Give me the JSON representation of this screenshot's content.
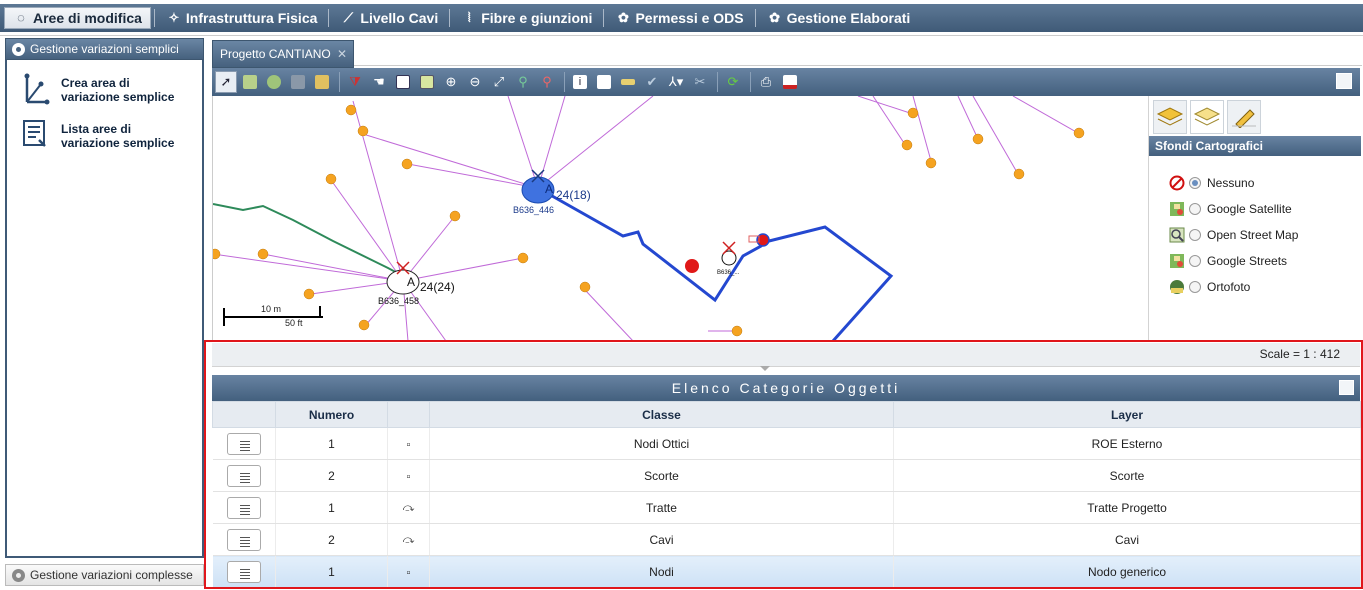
{
  "menu": {
    "items": [
      {
        "label": "Aree di modifica",
        "icon": "area-icon",
        "active": true
      },
      {
        "label": "Infrastruttura Fisica",
        "icon": "infrastructure-icon",
        "active": false
      },
      {
        "label": "Livello Cavi",
        "icon": "cable-icon",
        "active": false
      },
      {
        "label": "Fibre e giunzioni",
        "icon": "fiber-icon",
        "active": false
      },
      {
        "label": "Permessi e ODS",
        "icon": "gear-icon",
        "active": false
      },
      {
        "label": "Gestione Elaborati",
        "icon": "gear-icon",
        "active": false
      }
    ]
  },
  "left_panel": {
    "header": "Gestione variazioni semplici",
    "items": [
      {
        "label": "Crea area di variazione semplice",
        "icon": "create-area-icon"
      },
      {
        "label": "Lista aree di variazione semplice",
        "icon": "list-area-icon"
      }
    ],
    "footer": "Gestione variazioni complesse"
  },
  "project_tab": {
    "label": "Progetto CANTIANO"
  },
  "map": {
    "labels": {
      "node_a": "B636_446",
      "node_a_count": "24(18)",
      "node_b": "B636_458",
      "node_b_count": "24(24)",
      "node_c": "B636_..."
    },
    "scalebar": {
      "metric": "10 m",
      "imperial": "50 ft"
    },
    "scale_text": "Scale = 1 : 412"
  },
  "carto": {
    "title": "Sfondi Cartografici",
    "options": [
      {
        "label": "Nessuno",
        "icon": "no-entry-icon",
        "selected": true
      },
      {
        "label": "Google Satellite",
        "icon": "map-icon",
        "selected": false
      },
      {
        "label": "Open Street Map",
        "icon": "map-icon",
        "selected": false
      },
      {
        "label": "Google Streets",
        "icon": "map-icon",
        "selected": false
      },
      {
        "label": "Ortofoto",
        "icon": "wms-icon",
        "selected": false
      }
    ]
  },
  "grid": {
    "title": "Elenco Categorie Oggetti",
    "columns": {
      "numero": "Numero",
      "classe": "Classe",
      "layer": "Layer"
    },
    "rows": [
      {
        "numero": "1",
        "type": "point",
        "classe": "Nodi Ottici",
        "layer": "ROE Esterno",
        "selected": false
      },
      {
        "numero": "2",
        "type": "point",
        "classe": "Scorte",
        "layer": "Scorte",
        "selected": false
      },
      {
        "numero": "1",
        "type": "line",
        "classe": "Tratte",
        "layer": "Tratte Progetto",
        "selected": false
      },
      {
        "numero": "2",
        "type": "line",
        "classe": "Cavi",
        "layer": "Cavi",
        "selected": false
      },
      {
        "numero": "1",
        "type": "point",
        "classe": "Nodi",
        "layer": "Nodo generico",
        "selected": true
      }
    ]
  }
}
